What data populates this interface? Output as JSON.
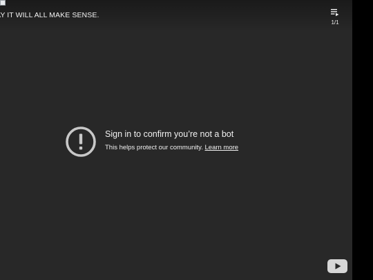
{
  "player": {
    "title": "AY IT WILL ALL MAKE SENSE.",
    "playlist": {
      "icon": "playlist-icon",
      "count": "1/1"
    }
  },
  "error": {
    "icon": "alert-icon",
    "title": "Sign in to confirm you’re not a bot",
    "message": "This helps protect our community.",
    "link_label": "Learn more"
  },
  "branding": {
    "icon": "youtube-logo-icon"
  },
  "colors": {
    "player_bg": "#282828",
    "text": "#f1f1f1",
    "alert_icon": "#c8c8c8"
  }
}
